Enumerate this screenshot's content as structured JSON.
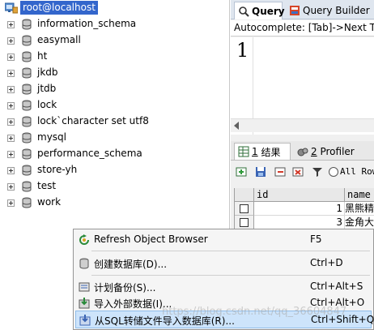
{
  "object_browser": {
    "root": {
      "label": "root@localhost",
      "icon": "server-icon"
    },
    "databases": [
      "information_schema",
      "easymall",
      "ht",
      "jkdb",
      "jtdb",
      "lock",
      "lock`character set utf8",
      "mysql",
      "performance_schema",
      "store-yh",
      "test",
      "work"
    ]
  },
  "query_tabs": {
    "query_label": "Query",
    "builder_label": "Query Builder"
  },
  "autocomplete_text": "Autocomplete: [Tab]->Next Tag",
  "editor": {
    "line_number": "1"
  },
  "result_tabs": {
    "result_num": "1",
    "result_label": "结果",
    "profiler_num": "2",
    "profiler_label": "Profiler"
  },
  "result_toolbar": {
    "all_rows_label": "All Rows"
  },
  "grid": {
    "columns": [
      "id",
      "name"
    ],
    "rows": [
      {
        "id": "1",
        "name": "黑熊精"
      },
      {
        "id": "3",
        "name": "金角大王"
      }
    ]
  },
  "context_menu": {
    "items": [
      {
        "label": "Refresh Object Browser",
        "shortcut": "F5",
        "icon": "refresh-icon"
      },
      {
        "label": "创建数据库(D)...",
        "shortcut": "Ctrl+D",
        "icon": "database-icon"
      },
      {
        "label": "计划备份(S)...",
        "shortcut": "Ctrl+Alt+S",
        "icon": "backup-icon"
      },
      {
        "label": "导入外部数据(I)...",
        "shortcut": "Ctrl+Alt+O",
        "icon": "import-icon"
      },
      {
        "label": "从SQL转储文件导入数据库(R)...",
        "shortcut": "Ctrl+Shift+Q",
        "icon": "sql-import-icon"
      }
    ]
  },
  "watermark_text": "https://blog.csdn.net/qq_36604847",
  "colors": {
    "selection": "#3366cc",
    "menu_highlight": "#cde4fb"
  }
}
